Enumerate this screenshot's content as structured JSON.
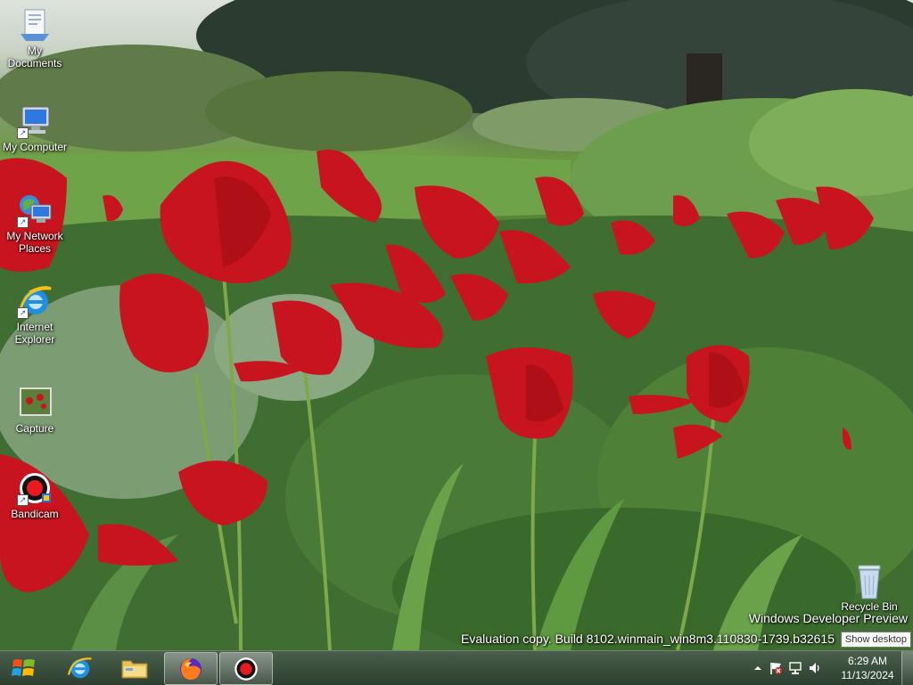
{
  "desktop": {
    "icons": [
      {
        "label": "My\nDocuments",
        "icon": "my-documents-icon"
      },
      {
        "label": "My Computer",
        "icon": "my-computer-icon"
      },
      {
        "label": "My Network\nPlaces",
        "icon": "network-places-icon"
      },
      {
        "label": "Internet\nExplorer",
        "icon": "internet-explorer-icon"
      },
      {
        "label": "Capture",
        "icon": "capture-icon"
      },
      {
        "label": "Bandicam",
        "icon": "bandicam-icon"
      },
      {
        "label": "Recycle Bin",
        "icon": "recycle-bin-icon"
      }
    ],
    "watermark_line1": "Windows Developer Preview",
    "watermark_line2": "Evaluation copy. Build 8102.winmain_win8m3.110830-1739.b32615",
    "tooltip": "Show desktop"
  },
  "taskbar": {
    "start_icon": "windows-logo-icon",
    "pinned": [
      {
        "name": "internet-explorer",
        "icon": "internet-explorer-icon",
        "active": false
      },
      {
        "name": "file-explorer",
        "icon": "folder-icon",
        "active": false
      },
      {
        "name": "firefox",
        "icon": "firefox-icon",
        "active": true
      },
      {
        "name": "bandicam",
        "icon": "bandicam-icon",
        "active": true
      }
    ],
    "tray": {
      "overflow_icon": "chevron-up-icon",
      "icons": [
        "action-center-flag-icon",
        "network-icon",
        "volume-icon"
      ],
      "time": "6:29 AM",
      "date": "11/13/2024"
    }
  },
  "colors": {
    "tulip_red": "#c8141e",
    "leaf_green": "#4f8a3a",
    "taskbar": "#2b4330"
  }
}
